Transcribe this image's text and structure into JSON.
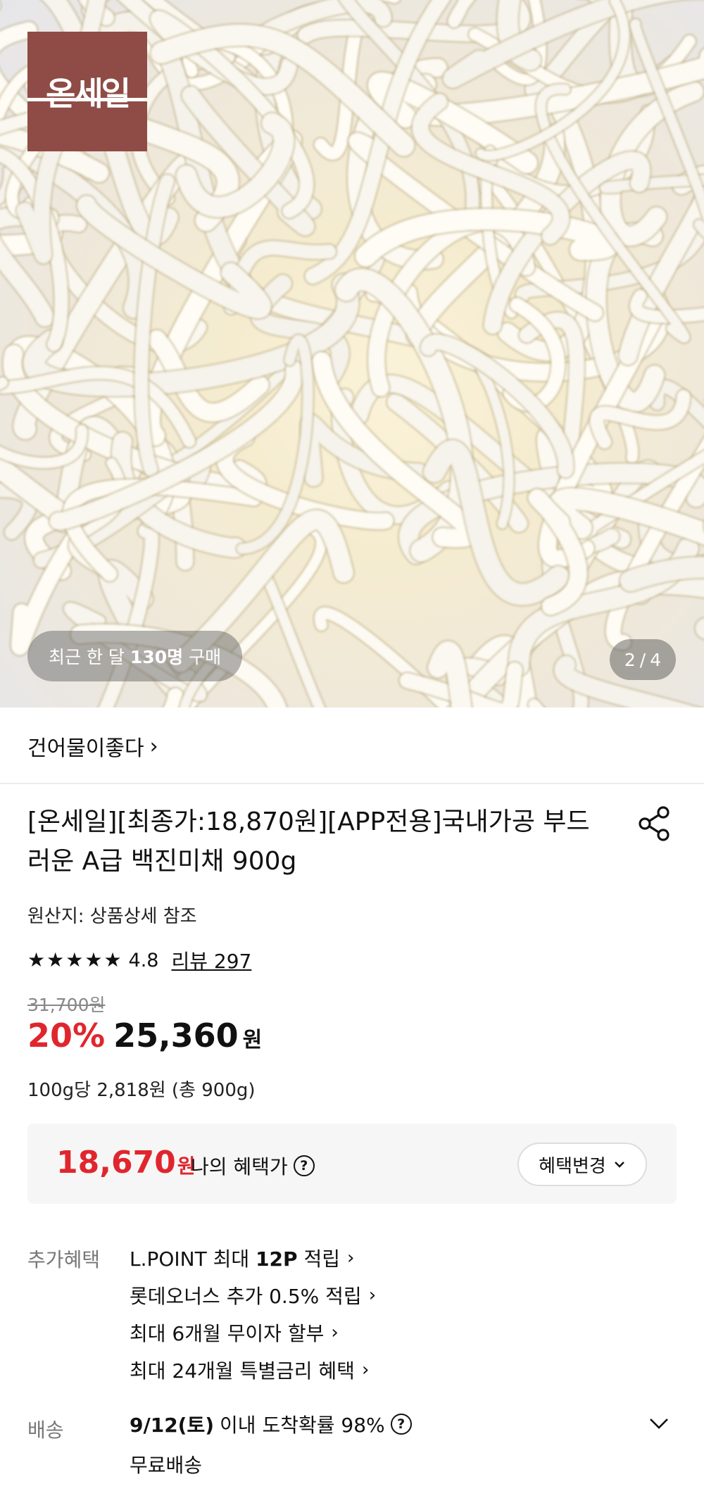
{
  "hero": {
    "brand_logo_text": "온세일",
    "buyer_prefix": "최근 한 달",
    "buyer_count": "130명",
    "buyer_suffix": "구매",
    "page_current": "2",
    "page_sep": "/",
    "page_total": "4"
  },
  "store": {
    "name": "건어물이좋다",
    "chevron": "›"
  },
  "product": {
    "title": "[온세일][최종가:18,870원][APP전용]국내가공 부드러운 A급 백진미채 900g",
    "origin": "원산지: 상품상세 참조",
    "rating": "4.8",
    "stars": 5,
    "review_label": "리뷰 297",
    "original_price": "31,700원",
    "discount": "20%",
    "price": "25,360",
    "price_unit": "원",
    "unit_price": "100g당 2,818원 (총 900g)"
  },
  "benefit": {
    "my_price": "18,670",
    "my_price_unit": "원",
    "my_price_label": "나의 혜택가",
    "help_symbol": "?",
    "change_button": "혜택변경"
  },
  "extra": {
    "label": "추가혜택",
    "items": [
      {
        "prefix": "L.POINT 최대 ",
        "bold": "12P",
        "suffix": " 적립"
      },
      {
        "prefix": "롯데오너스 추가 0.5% 적립",
        "bold": "",
        "suffix": ""
      },
      {
        "prefix": "최대 6개월 무이자 할부",
        "bold": "",
        "suffix": ""
      },
      {
        "prefix": "최대 24개월 특별금리 혜택",
        "bold": "",
        "suffix": ""
      }
    ]
  },
  "delivery": {
    "label": "배송",
    "date": "9/12(토)",
    "text": "이내 도착확률 98%",
    "fee": "무료배송"
  },
  "colors": {
    "accent_red": "#e0262d",
    "logo_bg": "#8f4b45"
  },
  "icons": [
    "share-icon",
    "star-icon",
    "help-icon",
    "chevron-right-icon",
    "chevron-down-icon"
  ]
}
